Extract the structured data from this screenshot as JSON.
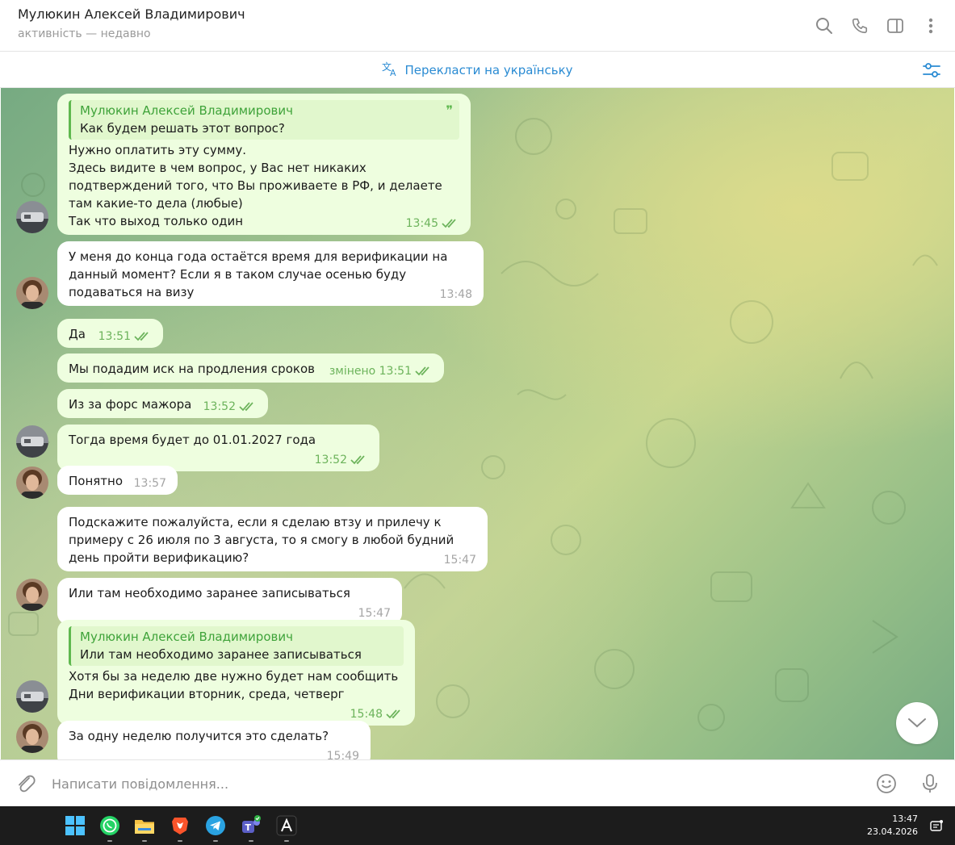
{
  "header": {
    "contact_name": "Мулюкин Алексей Владимирович",
    "status": "активність — недавно",
    "icons": [
      "search-icon",
      "phone-icon",
      "sidebar-toggle-icon",
      "more-vertical-icon"
    ]
  },
  "translate_bar": {
    "label": "Перекласти на українську",
    "icon": "translate-icon",
    "filter_icon": "filter-settings-icon"
  },
  "messages": [
    {
      "dir": "out",
      "quote_name": "Мулюкин Алексей Владимирович",
      "quote_text": "Как будем решать этот вопрос?",
      "text": "Нужно оплатить эту сумму.\nЗдесь видите в чем вопрос, у Вас нет никаких подтверждений того, что Вы проживаете в РФ, и делаете там какие-то дела (любые)\nТак что выход только один",
      "time": "13:45",
      "read": true
    },
    {
      "dir": "in",
      "text": "У меня до конца года остаётся время для верификации на данный момент? Если я в таком случае осенью буду подаваться на визу",
      "time": "13:48"
    },
    {
      "dir": "out",
      "text": "Да",
      "time": "13:51",
      "read": true
    },
    {
      "dir": "out",
      "text": "Мы подадим иск на продления сроков",
      "time": "змінено 13:51",
      "read": true
    },
    {
      "dir": "out",
      "text": "Из за форс мажора",
      "time": "13:52",
      "read": true
    },
    {
      "dir": "out",
      "text": "Тогда время будет до 01.01.2027 года",
      "time": "13:52",
      "read": true
    },
    {
      "dir": "in",
      "text": "Понятно",
      "time": "13:57"
    },
    {
      "dir": "in",
      "text": "Подскажите пожалуйста, если я сделаю втзу и прилечу к примеру с 26 июля по 3 августа, то я смогу в любой будний день пройти верификацию?",
      "time": "15:47"
    },
    {
      "dir": "in",
      "text": "Или там необходимо заранее записываться",
      "time": "15:47"
    },
    {
      "dir": "out",
      "quote_name": "Мулюкин Алексей Владимирович",
      "quote_text": "Или там необходимо заранее записываться",
      "text": "Хотя бы за неделю две нужно будет нам сообщить\nДни верификации вторник, среда, четверг",
      "time": "15:48",
      "read": true
    },
    {
      "dir": "in",
      "text": "За одну неделю получится это сделать?",
      "time": "15:49"
    }
  ],
  "composer": {
    "placeholder": "Написати повідомлення...",
    "icons": [
      "attach-icon",
      "emoji-icon",
      "microphone-icon"
    ]
  },
  "taskbar": {
    "apps": [
      "windows-start-icon",
      "whatsapp-icon",
      "file-explorer-icon",
      "brave-browser-icon",
      "telegram-icon",
      "teams-icon",
      "acrobat-icon"
    ],
    "time": "13:47",
    "date": "23.04.2026"
  },
  "colors": {
    "accent": "#2a8bd3",
    "out_bubble": "#eefedf",
    "in_bubble": "#ffffff",
    "read_ticks": "#6cb35b",
    "quote_name": "#3fa33a"
  }
}
